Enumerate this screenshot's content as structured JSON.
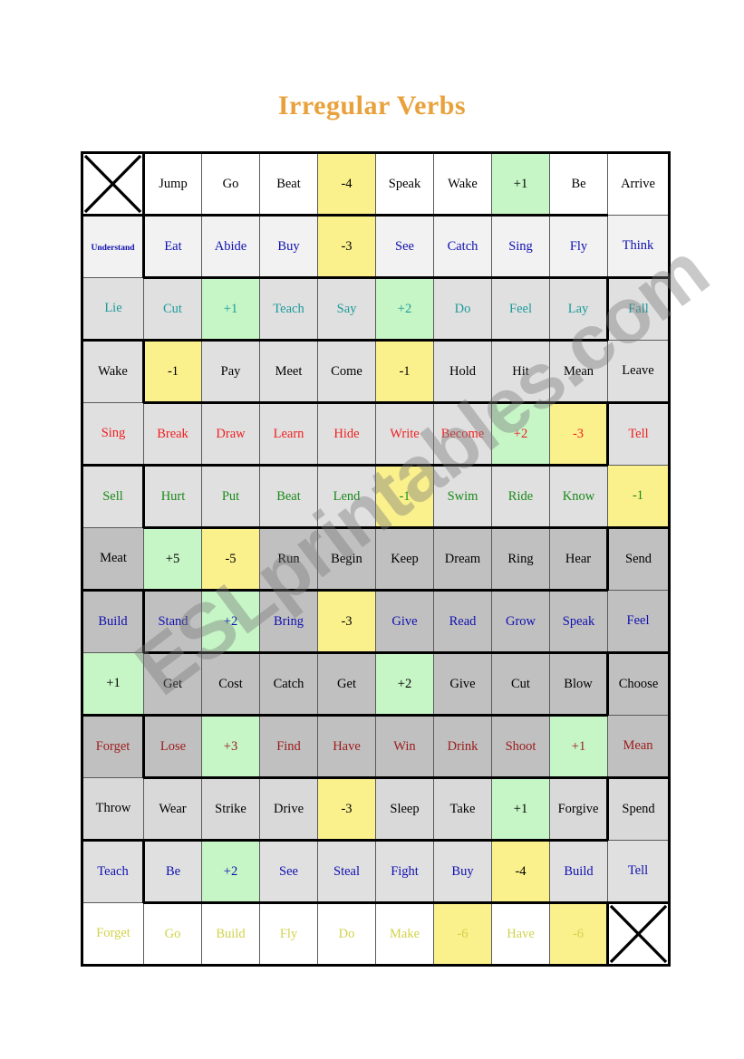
{
  "title": "Irregular Verbs",
  "watermark": "ESLprintables.com",
  "colors": {
    "title": "#e9a13b",
    "yellow": "#faf08c",
    "green": "#c6f5c6",
    "blue_text": "#1010b0",
    "teal_text": "#1c9b9b",
    "red_text": "#f02020",
    "green_text": "#1a8a1a",
    "darkred_text": "#9b1a1a",
    "olive_text": "#d2d24a"
  },
  "board": {
    "columns": 10,
    "rows": 13,
    "cells": [
      [
        {
          "label": "",
          "kind": "cross",
          "fill": "white"
        },
        {
          "label": "Jump",
          "fill": "white",
          "text": "black"
        },
        {
          "label": "Go",
          "fill": "white",
          "text": "black"
        },
        {
          "label": "Beat",
          "fill": "white",
          "text": "black"
        },
        {
          "label": "-4",
          "fill": "yellow",
          "text": "black"
        },
        {
          "label": "Speak",
          "fill": "white",
          "text": "black"
        },
        {
          "label": "Wake",
          "fill": "white",
          "text": "black"
        },
        {
          "label": "+1",
          "fill": "green",
          "text": "black"
        },
        {
          "label": "Be",
          "fill": "white",
          "text": "black"
        },
        {
          "label": "Arrive",
          "fill": "white",
          "text": "black"
        }
      ],
      [
        {
          "label": "Understand",
          "fill": "gray1",
          "text": "blue",
          "size": "small"
        },
        {
          "label": "Eat",
          "fill": "gray1",
          "text": "blue"
        },
        {
          "label": "Abide",
          "fill": "gray1",
          "text": "blue"
        },
        {
          "label": "Buy",
          "fill": "gray1",
          "text": "blue"
        },
        {
          "label": "-3",
          "fill": "yellow",
          "text": "black"
        },
        {
          "label": "See",
          "fill": "gray1",
          "text": "blue"
        },
        {
          "label": "Catch",
          "fill": "gray1",
          "text": "blue"
        },
        {
          "label": "Sing",
          "fill": "gray1",
          "text": "blue"
        },
        {
          "label": "Fly",
          "fill": "gray1",
          "text": "blue"
        },
        {
          "label": "Think",
          "fill": "gray1",
          "text": "blue"
        }
      ],
      [
        {
          "label": "Lie",
          "fill": "gray2",
          "text": "teal"
        },
        {
          "label": "Cut",
          "fill": "gray2",
          "text": "teal"
        },
        {
          "label": "+1",
          "fill": "green",
          "text": "teal"
        },
        {
          "label": "Teach",
          "fill": "gray2",
          "text": "teal"
        },
        {
          "label": "Say",
          "fill": "gray2",
          "text": "teal"
        },
        {
          "label": "+2",
          "fill": "green",
          "text": "teal"
        },
        {
          "label": "Do",
          "fill": "gray2",
          "text": "teal"
        },
        {
          "label": "Feel",
          "fill": "gray2",
          "text": "teal"
        },
        {
          "label": "Lay",
          "fill": "gray2",
          "text": "teal"
        },
        {
          "label": "Fall",
          "fill": "gray2",
          "text": "teal"
        }
      ],
      [
        {
          "label": "Wake",
          "fill": "gray2",
          "text": "black"
        },
        {
          "label": "-1",
          "fill": "yellow",
          "text": "black"
        },
        {
          "label": "Pay",
          "fill": "gray2",
          "text": "black"
        },
        {
          "label": "Meet",
          "fill": "gray2",
          "text": "black"
        },
        {
          "label": "Come",
          "fill": "gray2",
          "text": "black"
        },
        {
          "label": "-1",
          "fill": "yellow",
          "text": "black"
        },
        {
          "label": "Hold",
          "fill": "gray2",
          "text": "black"
        },
        {
          "label": "Hit",
          "fill": "gray2",
          "text": "black"
        },
        {
          "label": "Mean",
          "fill": "gray2",
          "text": "black"
        },
        {
          "label": "Leave",
          "fill": "gray2",
          "text": "black"
        }
      ],
      [
        {
          "label": "Sing",
          "fill": "gray2",
          "text": "red"
        },
        {
          "label": "Break",
          "fill": "gray2",
          "text": "red"
        },
        {
          "label": "Draw",
          "fill": "gray2",
          "text": "red"
        },
        {
          "label": "Learn",
          "fill": "gray2",
          "text": "red"
        },
        {
          "label": "Hide",
          "fill": "gray2",
          "text": "red"
        },
        {
          "label": "Write",
          "fill": "gray2",
          "text": "red"
        },
        {
          "label": "Become",
          "fill": "gray2",
          "text": "red"
        },
        {
          "label": "+2",
          "fill": "green",
          "text": "red"
        },
        {
          "label": "-3",
          "fill": "yellow",
          "text": "red"
        },
        {
          "label": "Tell",
          "fill": "gray2",
          "text": "red"
        }
      ],
      [
        {
          "label": "Sell",
          "fill": "gray2",
          "text": "green"
        },
        {
          "label": "Hurt",
          "fill": "gray2",
          "text": "green"
        },
        {
          "label": "Put",
          "fill": "gray2",
          "text": "green"
        },
        {
          "label": "Beat",
          "fill": "gray2",
          "text": "green"
        },
        {
          "label": "Lend",
          "fill": "gray2",
          "text": "green"
        },
        {
          "label": "-1",
          "fill": "yellow",
          "text": "green"
        },
        {
          "label": "Swim",
          "fill": "gray2",
          "text": "green"
        },
        {
          "label": "Ride",
          "fill": "gray2",
          "text": "green"
        },
        {
          "label": "Know",
          "fill": "gray2",
          "text": "green"
        },
        {
          "label": "-1",
          "fill": "yellow",
          "text": "green"
        }
      ],
      [
        {
          "label": "Meat",
          "fill": "gray4",
          "text": "black"
        },
        {
          "label": "+5",
          "fill": "green",
          "text": "black"
        },
        {
          "label": "-5",
          "fill": "yellow",
          "text": "black"
        },
        {
          "label": "Run",
          "fill": "gray4",
          "text": "black"
        },
        {
          "label": "Begin",
          "fill": "gray4",
          "text": "black"
        },
        {
          "label": "Keep",
          "fill": "gray4",
          "text": "black"
        },
        {
          "label": "Dream",
          "fill": "gray4",
          "text": "black"
        },
        {
          "label": "Ring",
          "fill": "gray4",
          "text": "black"
        },
        {
          "label": "Hear",
          "fill": "gray4",
          "text": "black"
        },
        {
          "label": "Send",
          "fill": "gray4",
          "text": "black"
        }
      ],
      [
        {
          "label": "Build",
          "fill": "gray4",
          "text": "blue"
        },
        {
          "label": "Stand",
          "fill": "gray4",
          "text": "blue"
        },
        {
          "label": "+2",
          "fill": "green",
          "text": "blue"
        },
        {
          "label": "Bring",
          "fill": "gray4",
          "text": "blue"
        },
        {
          "label": "-3",
          "fill": "yellow",
          "text": "black"
        },
        {
          "label": "Give",
          "fill": "gray4",
          "text": "blue"
        },
        {
          "label": "Read",
          "fill": "gray4",
          "text": "blue"
        },
        {
          "label": "Grow",
          "fill": "gray4",
          "text": "blue"
        },
        {
          "label": "Speak",
          "fill": "gray4",
          "text": "blue"
        },
        {
          "label": "Feel",
          "fill": "gray4",
          "text": "blue"
        }
      ],
      [
        {
          "label": "+1",
          "fill": "green",
          "text": "black"
        },
        {
          "label": "Get",
          "fill": "gray4",
          "text": "black"
        },
        {
          "label": "Cost",
          "fill": "gray4",
          "text": "black"
        },
        {
          "label": "Catch",
          "fill": "gray4",
          "text": "black"
        },
        {
          "label": "Get",
          "fill": "gray4",
          "text": "black"
        },
        {
          "label": "+2",
          "fill": "green",
          "text": "black"
        },
        {
          "label": "Give",
          "fill": "gray4",
          "text": "black"
        },
        {
          "label": "Cut",
          "fill": "gray4",
          "text": "black"
        },
        {
          "label": "Blow",
          "fill": "gray4",
          "text": "black"
        },
        {
          "label": "Choose",
          "fill": "gray4",
          "text": "black"
        }
      ],
      [
        {
          "label": "Forget",
          "fill": "gray4",
          "text": "darkred"
        },
        {
          "label": "Lose",
          "fill": "gray4",
          "text": "darkred"
        },
        {
          "label": "+3",
          "fill": "green",
          "text": "darkred"
        },
        {
          "label": "Find",
          "fill": "gray4",
          "text": "darkred"
        },
        {
          "label": "Have",
          "fill": "gray4",
          "text": "darkred"
        },
        {
          "label": "Win",
          "fill": "gray4",
          "text": "darkred"
        },
        {
          "label": "Drink",
          "fill": "gray4",
          "text": "darkred"
        },
        {
          "label": "Shoot",
          "fill": "gray4",
          "text": "darkred"
        },
        {
          "label": "+1",
          "fill": "green",
          "text": "darkred"
        },
        {
          "label": "Mean",
          "fill": "gray4",
          "text": "darkred"
        }
      ],
      [
        {
          "label": "Throw",
          "fill": "gray3",
          "text": "black"
        },
        {
          "label": "Wear",
          "fill": "gray3",
          "text": "black"
        },
        {
          "label": "Strike",
          "fill": "gray3",
          "text": "black"
        },
        {
          "label": "Drive",
          "fill": "gray3",
          "text": "black"
        },
        {
          "label": "-3",
          "fill": "yellow",
          "text": "black"
        },
        {
          "label": "Sleep",
          "fill": "gray3",
          "text": "black"
        },
        {
          "label": "Take",
          "fill": "gray3",
          "text": "black"
        },
        {
          "label": "+1",
          "fill": "green",
          "text": "black"
        },
        {
          "label": "Forgive",
          "fill": "gray3",
          "text": "black"
        },
        {
          "label": "Spend",
          "fill": "gray3",
          "text": "black"
        }
      ],
      [
        {
          "label": "Teach",
          "fill": "gray2",
          "text": "blue"
        },
        {
          "label": "Be",
          "fill": "gray2",
          "text": "blue"
        },
        {
          "label": "+2",
          "fill": "green",
          "text": "blue"
        },
        {
          "label": "See",
          "fill": "gray2",
          "text": "blue"
        },
        {
          "label": "Steal",
          "fill": "gray2",
          "text": "blue"
        },
        {
          "label": "Fight",
          "fill": "gray2",
          "text": "blue"
        },
        {
          "label": "Buy",
          "fill": "gray2",
          "text": "blue"
        },
        {
          "label": "-4",
          "fill": "yellow",
          "text": "black"
        },
        {
          "label": "Build",
          "fill": "gray2",
          "text": "blue"
        },
        {
          "label": "Tell",
          "fill": "gray2",
          "text": "blue"
        }
      ],
      [
        {
          "label": "Forget",
          "fill": "white",
          "text": "olive"
        },
        {
          "label": "Go",
          "fill": "white",
          "text": "olive"
        },
        {
          "label": "Build",
          "fill": "white",
          "text": "olive"
        },
        {
          "label": "Fly",
          "fill": "white",
          "text": "olive"
        },
        {
          "label": "Do",
          "fill": "white",
          "text": "olive"
        },
        {
          "label": "Make",
          "fill": "white",
          "text": "olive"
        },
        {
          "label": "-6",
          "fill": "yellow",
          "text": "olive"
        },
        {
          "label": "Have",
          "fill": "white",
          "text": "olive"
        },
        {
          "label": "-6",
          "fill": "yellow",
          "text": "olive"
        },
        {
          "label": "",
          "kind": "cross",
          "fill": "white"
        }
      ]
    ],
    "thick_edges": {
      "_comment": "serpentine path borders: row index -> list of [col, sides]",
      "0": [
        [
          0,
          "TBLR"
        ],
        [
          9,
          "L"
        ]
      ],
      "1": [
        [
          0,
          "B"
        ],
        [
          9,
          "R"
        ]
      ],
      "2": [
        [
          0,
          "T"
        ],
        [
          9,
          "BR"
        ]
      ],
      "3": [
        [
          0,
          "B"
        ],
        [
          9,
          "T"
        ]
      ],
      "4": [
        [
          0,
          "T"
        ],
        [
          9,
          "B"
        ]
      ],
      "5": [
        [
          0,
          "B"
        ],
        [
          9,
          "T"
        ]
      ],
      "6": [
        [
          0,
          "T"
        ],
        [
          9,
          "B"
        ]
      ],
      "7": [
        [
          0,
          "B"
        ],
        [
          9,
          "T"
        ]
      ],
      "8": [
        [
          0,
          "T"
        ],
        [
          9,
          "B"
        ]
      ],
      "9": [
        [
          0,
          "B"
        ],
        [
          9,
          "T"
        ]
      ],
      "10": [
        [
          0,
          "T"
        ],
        [
          9,
          "B"
        ]
      ],
      "11": [
        [
          0,
          "B"
        ],
        [
          9,
          "T"
        ]
      ],
      "12": [
        [
          9,
          "TBLR"
        ]
      ]
    }
  }
}
